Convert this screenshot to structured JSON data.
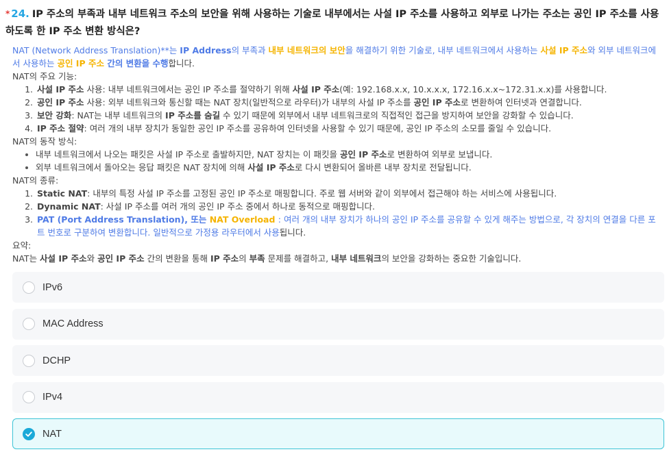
{
  "question": {
    "required_mark": "*",
    "number": "24.",
    "text": "IP 주소의 부족과 내부 네트워크 주소의 보안을 위해 사용하는 기술로 내부에서는 사설 IP 주소를 사용하고 외부로 나가는 주소는 공인 IP 주소를 사용하도록 한 IP 주소 변환 방식은?"
  },
  "explanation": {
    "intro": {
      "p1": "NAT (Network Address Translation)**는 ",
      "p2": "IP Address",
      "p3": "의 부족과 ",
      "p4": "내부 네트워크의 보안",
      "p5": "을 해결하기 위한 기술로, 내부 네트워크에서 사용하는 ",
      "p6": "사설 IP 주소",
      "p7": "와 외부 네트워크에서 사용하는 ",
      "p8": "공인 IP 주소",
      "p9": " 간의 변환을 수행",
      "p10": "합니다."
    },
    "features_heading": "NAT의 주요 기능:",
    "features": [
      {
        "b": "사설 IP 주소",
        "t1": " 사용: 내부 네트워크에서는 공인 IP 주소를 절약하기 위해 ",
        "b2": "사설 IP 주소",
        "t2": "(예: 192.168.x.x, 10.x.x.x, 172.16.x.x~172.31.x.x)를 사용합니다."
      },
      {
        "b": "공인 IP 주소",
        "t1": " 사용: 외부 네트워크와 통신할 때는 NAT 장치(일반적으로 라우터)가 내부의 사설 IP 주소를 ",
        "b2": "공인 IP 주소",
        "t2": "로 변환하여 인터넷과 연결합니다."
      },
      {
        "b": "보안 강화",
        "t1": ": NAT는 내부 네트워크의 ",
        "b2": "IP 주소를 숨길",
        "t2": " 수 있기 때문에 외부에서 내부 네트워크로의 직접적인 접근을 방지하여 보안을 강화할 수 있습니다."
      },
      {
        "b": "IP 주소 절약",
        "t1": ": 여러 개의 내부 장치가 동일한 공인 IP 주소를 공유하여 인터넷을 사용할 수 있기 때문에, 공인 IP 주소의 소모를 줄일 수 있습니다.",
        "b2": "",
        "t2": ""
      }
    ],
    "operation_heading": "NAT의 동작 방식:",
    "operation": [
      {
        "t1": "내부 네트워크에서 나오는 패킷은 사설 IP 주소로 출발하지만, NAT 장치는 이 패킷을 ",
        "b": "공인 IP 주소",
        "t2": "로 변환하여 외부로 보냅니다."
      },
      {
        "t1": "외부 네트워크에서 돌아오는 응답 패킷은 NAT 장치에 의해 ",
        "b": "사설 IP 주소",
        "t2": "로 다시 변환되어 올바른 내부 장치로 전달됩니다."
      }
    ],
    "types_heading": "NAT의 종류:",
    "types": [
      {
        "b": "Static NAT",
        "t": ": 내부의 특정 사설 IP 주소를 고정된 공인 IP 주소로 매핑합니다. 주로 웹 서버와 같이 외부에서 접근해야 하는 서비스에 사용됩니다."
      },
      {
        "b": "Dynamic NAT",
        "t": ": 사설 IP 주소를 여러 개의 공인 IP 주소 중에서 하나로 동적으로 매핑합니다."
      }
    ],
    "type3": {
      "b1": "PAT (Port Address Translation), 또는 ",
      "b2": " NAT Overload ",
      "t1": ": 여러 개의 내부 장치가 하나의 공인 IP 주소를 공유할 수 있게 해주는 방법으로, 각 장치의 연결을 다른 포트 번호로 구분하여 변환합니다. 일반적으로 가정용 라우터에서 사용",
      "t2": "됩니다."
    },
    "summary_heading": "요약:",
    "summary": {
      "s1": "NAT는 ",
      "s2": "사설 IP 주소",
      "s3": "와 ",
      "s4": "공인 IP 주소",
      "s5": " 간의 변환을 통해 ",
      "s6": "IP 주소",
      "s7": "의 ",
      "s8": "부족",
      "s9": " 문제를 해결하고, ",
      "s10": "내부 네트워크",
      "s11": "의 보안을 강화하는 중요한 기술입니다."
    }
  },
  "options": [
    {
      "label": "IPv6",
      "selected": false
    },
    {
      "label": "MAC Address",
      "selected": false
    },
    {
      "label": "DCHP",
      "selected": false
    },
    {
      "label": "IPv4",
      "selected": false
    },
    {
      "label": "NAT",
      "selected": true
    }
  ],
  "colors": {
    "accent": "#26a6e3",
    "highlight_blue": "#4f7be6",
    "highlight_gold": "#f5b400",
    "selected_border": "#3cc4d6",
    "selected_bg": "#e8fafc"
  }
}
